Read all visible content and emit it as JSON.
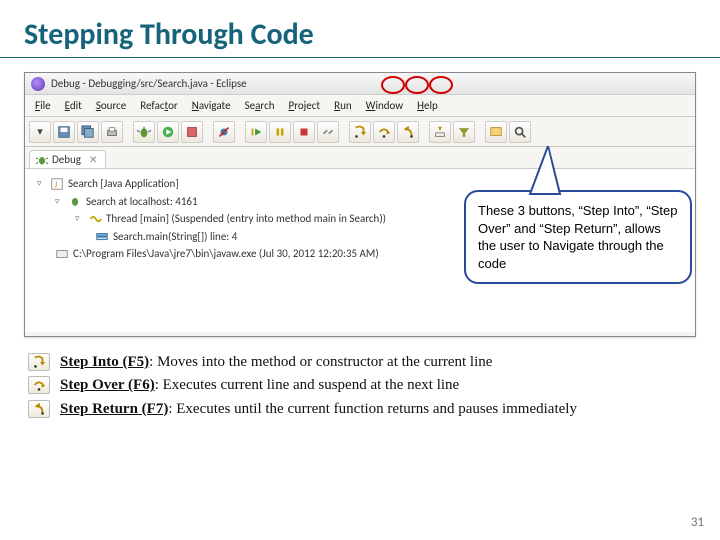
{
  "slide": {
    "title": "Stepping Through Code",
    "page_number": "31"
  },
  "window": {
    "title": "Debug - Debugging/src/Search.java - Eclipse",
    "menu": [
      "File",
      "Edit",
      "Source",
      "Refactor",
      "Navigate",
      "Search",
      "Project",
      "Run",
      "Window",
      "Help"
    ],
    "debug_tab": "Debug",
    "tree": {
      "app": "Search [Java Application]",
      "conn": "Search at localhost: 4161",
      "thread": "Thread [main] (Suspended (entry into method main in Search))",
      "frame": "Search.main(String[]) line: 4",
      "vm": "C:\\Program Files\\Java\\jre7\\bin\\javaw.exe (Jul 30, 2012 12:20:35 AM)"
    }
  },
  "callout": {
    "text": "These 3 buttons, “Step Into”, “Step Over” and “Step Return”, allows the user to Navigate through the code"
  },
  "legend": {
    "into": {
      "key": "Step Into (F5)",
      "desc": ":  Moves into the method or constructor at the current line"
    },
    "over": {
      "key": "Step Over (F6)",
      "desc": ":  Executes current line and suspend at the next line"
    },
    "ret": {
      "key": "Step Return (F7)",
      "desc": ":  Executes until the current function returns and pauses immediately"
    }
  }
}
